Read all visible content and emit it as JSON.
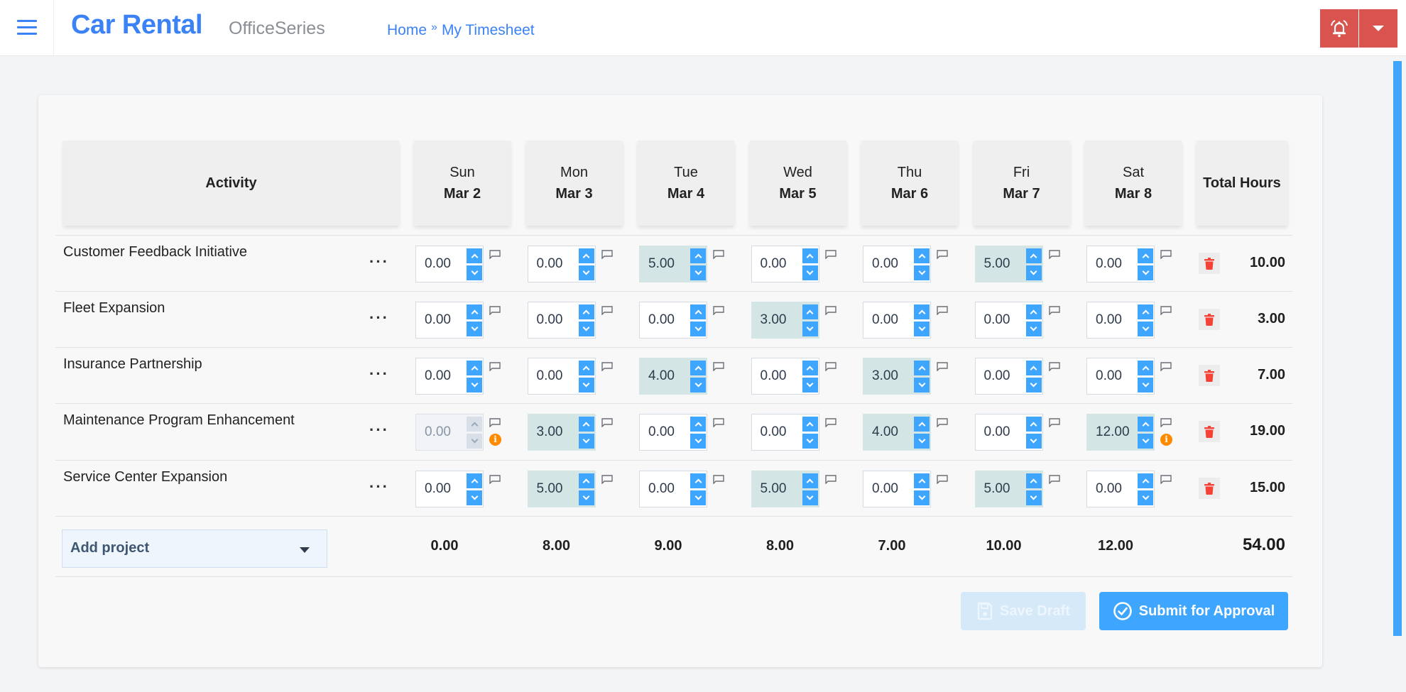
{
  "header": {
    "app_title": "Car Rental",
    "suite_name": "OfficeSeries",
    "breadcrumb": [
      {
        "label": "Home"
      },
      {
        "label": "My Timesheet"
      }
    ],
    "breadcrumb_separator": "»",
    "icons": {
      "menu": "hamburger-icon",
      "alert": "bell-ring-icon",
      "dropdown": "caret-down-icon"
    }
  },
  "colors": {
    "brand": "#3b82f6",
    "alert": "#d9534f",
    "spinner": "#3ea6ff",
    "filled_cell": "#d3e6e5",
    "trash": "#f44336",
    "info": "#ff8a00"
  },
  "timesheet": {
    "activity_header": "Activity",
    "total_header": "Total Hours",
    "days": [
      {
        "name": "Sun",
        "date": "Mar 2"
      },
      {
        "name": "Mon",
        "date": "Mar 3"
      },
      {
        "name": "Tue",
        "date": "Mar 4"
      },
      {
        "name": "Wed",
        "date": "Mar 5"
      },
      {
        "name": "Thu",
        "date": "Mar 6"
      },
      {
        "name": "Fri",
        "date": "Mar 7"
      },
      {
        "name": "Sat",
        "date": "Mar 8"
      }
    ],
    "rows": [
      {
        "activity": "Customer Feedback Initiative",
        "menu_label": "...",
        "hours": [
          "0.00",
          "0.00",
          "5.00",
          "0.00",
          "0.00",
          "5.00",
          "0.00"
        ],
        "filled": [
          false,
          false,
          true,
          false,
          false,
          true,
          false
        ],
        "disabled": [
          false,
          false,
          false,
          false,
          false,
          false,
          false
        ],
        "info": [
          false,
          false,
          false,
          false,
          false,
          false,
          false
        ],
        "total": "10.00"
      },
      {
        "activity": "Fleet Expansion",
        "menu_label": "...",
        "hours": [
          "0.00",
          "0.00",
          "0.00",
          "3.00",
          "0.00",
          "0.00",
          "0.00"
        ],
        "filled": [
          false,
          false,
          false,
          true,
          false,
          false,
          false
        ],
        "disabled": [
          false,
          false,
          false,
          false,
          false,
          false,
          false
        ],
        "info": [
          false,
          false,
          false,
          false,
          false,
          false,
          false
        ],
        "total": "3.00"
      },
      {
        "activity": "Insurance Partnership",
        "menu_label": "...",
        "hours": [
          "0.00",
          "0.00",
          "4.00",
          "0.00",
          "3.00",
          "0.00",
          "0.00"
        ],
        "filled": [
          false,
          false,
          true,
          false,
          true,
          false,
          false
        ],
        "disabled": [
          false,
          false,
          false,
          false,
          false,
          false,
          false
        ],
        "info": [
          false,
          false,
          false,
          false,
          false,
          false,
          false
        ],
        "total": "7.00"
      },
      {
        "activity": "Maintenance Program Enhancement",
        "menu_label": "...",
        "hours": [
          "0.00",
          "3.00",
          "0.00",
          "0.00",
          "4.00",
          "0.00",
          "12.00"
        ],
        "filled": [
          false,
          true,
          false,
          false,
          true,
          false,
          true
        ],
        "disabled": [
          true,
          false,
          false,
          false,
          false,
          false,
          false
        ],
        "info": [
          true,
          false,
          false,
          false,
          false,
          false,
          true
        ],
        "total": "19.00"
      },
      {
        "activity": "Service Center Expansion",
        "menu_label": "...",
        "hours": [
          "0.00",
          "5.00",
          "0.00",
          "5.00",
          "0.00",
          "5.00",
          "0.00"
        ],
        "filled": [
          false,
          true,
          false,
          true,
          false,
          true,
          false
        ],
        "disabled": [
          false,
          false,
          false,
          false,
          false,
          false,
          false
        ],
        "info": [
          false,
          false,
          false,
          false,
          false,
          false,
          false
        ],
        "total": "15.00"
      }
    ],
    "add_project_label": "Add project",
    "day_totals": [
      "0.00",
      "8.00",
      "9.00",
      "8.00",
      "7.00",
      "10.00",
      "12.00"
    ],
    "grand_total": "54.00",
    "info_glyph": "i"
  },
  "actions": {
    "save_draft": "Save Draft",
    "submit": "Submit for Approval"
  }
}
